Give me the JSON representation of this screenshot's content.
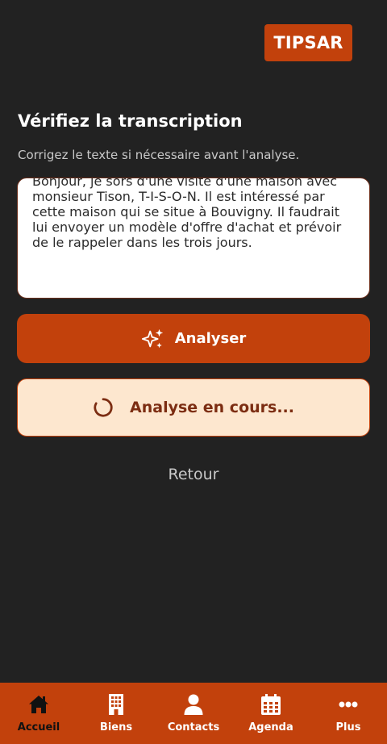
{
  "header": {
    "logo_text": "TIPSAR"
  },
  "main": {
    "title": "Vérifiez la transcription",
    "subtitle": "Corrigez le texte si nécessaire avant l'analyse.",
    "transcription": "Bonjour, je sors d'une visite d'une maison avec monsieur Tison, T-I-S-O-N. Il est intéressé par cette maison qui se situe à Bouvigny. Il faudrait lui envoyer un modèle d'offre d'achat et prévoir de le rappeler dans les trois jours.",
    "analyze_button": {
      "label": "Analyser",
      "icon": "sparkles-icon"
    },
    "loading_button": {
      "label": "Analyse en cours...",
      "icon": "spinner-icon"
    },
    "back_label": "Retour"
  },
  "bottom_nav": {
    "items": [
      {
        "label": "Accueil",
        "icon": "home-icon",
        "active": true
      },
      {
        "label": "Biens",
        "icon": "building-icon",
        "active": false
      },
      {
        "label": "Contacts",
        "icon": "user-icon",
        "active": false
      },
      {
        "label": "Agenda",
        "icon": "calendar-icon",
        "active": false
      },
      {
        "label": "Plus",
        "icon": "more-icon",
        "active": false
      }
    ]
  },
  "colors": {
    "background": "#222222",
    "accent": "#c2410c",
    "loading_bg": "#fde7cf",
    "loading_text": "#7c2d12",
    "active_nav_text": "#111111"
  }
}
